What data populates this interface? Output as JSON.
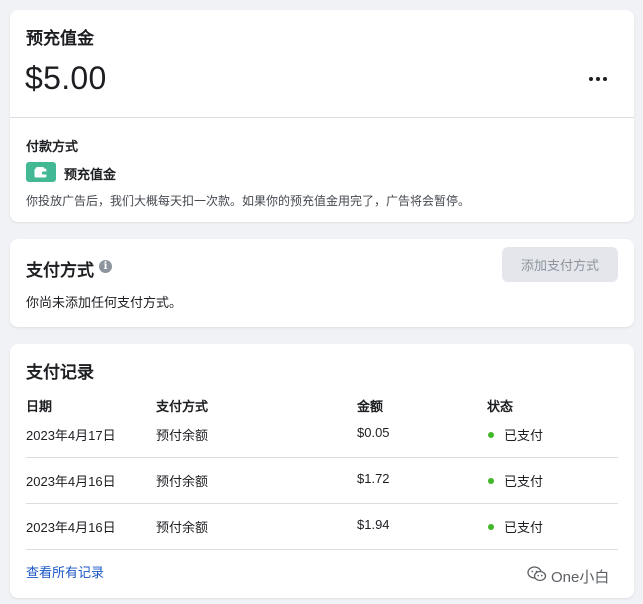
{
  "prepaid_card": {
    "title": "预充值金",
    "amount": "$5.00",
    "payment_method_label": "付款方式",
    "payment_method_name": "预充值金",
    "description": "你投放广告后，我们大概每天扣一次款。如果你的预充值金用完了，广告将会暂停。"
  },
  "methods_card": {
    "title": "支付方式",
    "add_button": "添加支付方式",
    "empty_text": "你尚未添加任何支付方式。"
  },
  "history_card": {
    "title": "支付记录",
    "columns": [
      "日期",
      "支付方式",
      "金额",
      "状态"
    ],
    "rows": [
      {
        "date": "2023年4月17日",
        "method": "预付余额",
        "amount": "$0.05",
        "status": "已支付"
      },
      {
        "date": "2023年4月16日",
        "method": "预付余额",
        "amount": "$1.72",
        "status": "已支付"
      },
      {
        "date": "2023年4月16日",
        "method": "预付余额",
        "amount": "$1.94",
        "status": "已支付"
      }
    ],
    "view_all_link": "查看所有记录"
  },
  "watermark": {
    "text": "One小白"
  },
  "colors": {
    "accent_green": "#42b894",
    "status_green": "#42b72a",
    "link_blue": "#1a57c7"
  },
  "icons": [
    "more-icon",
    "wallet-icon",
    "info-icon",
    "wechat-icon"
  ]
}
